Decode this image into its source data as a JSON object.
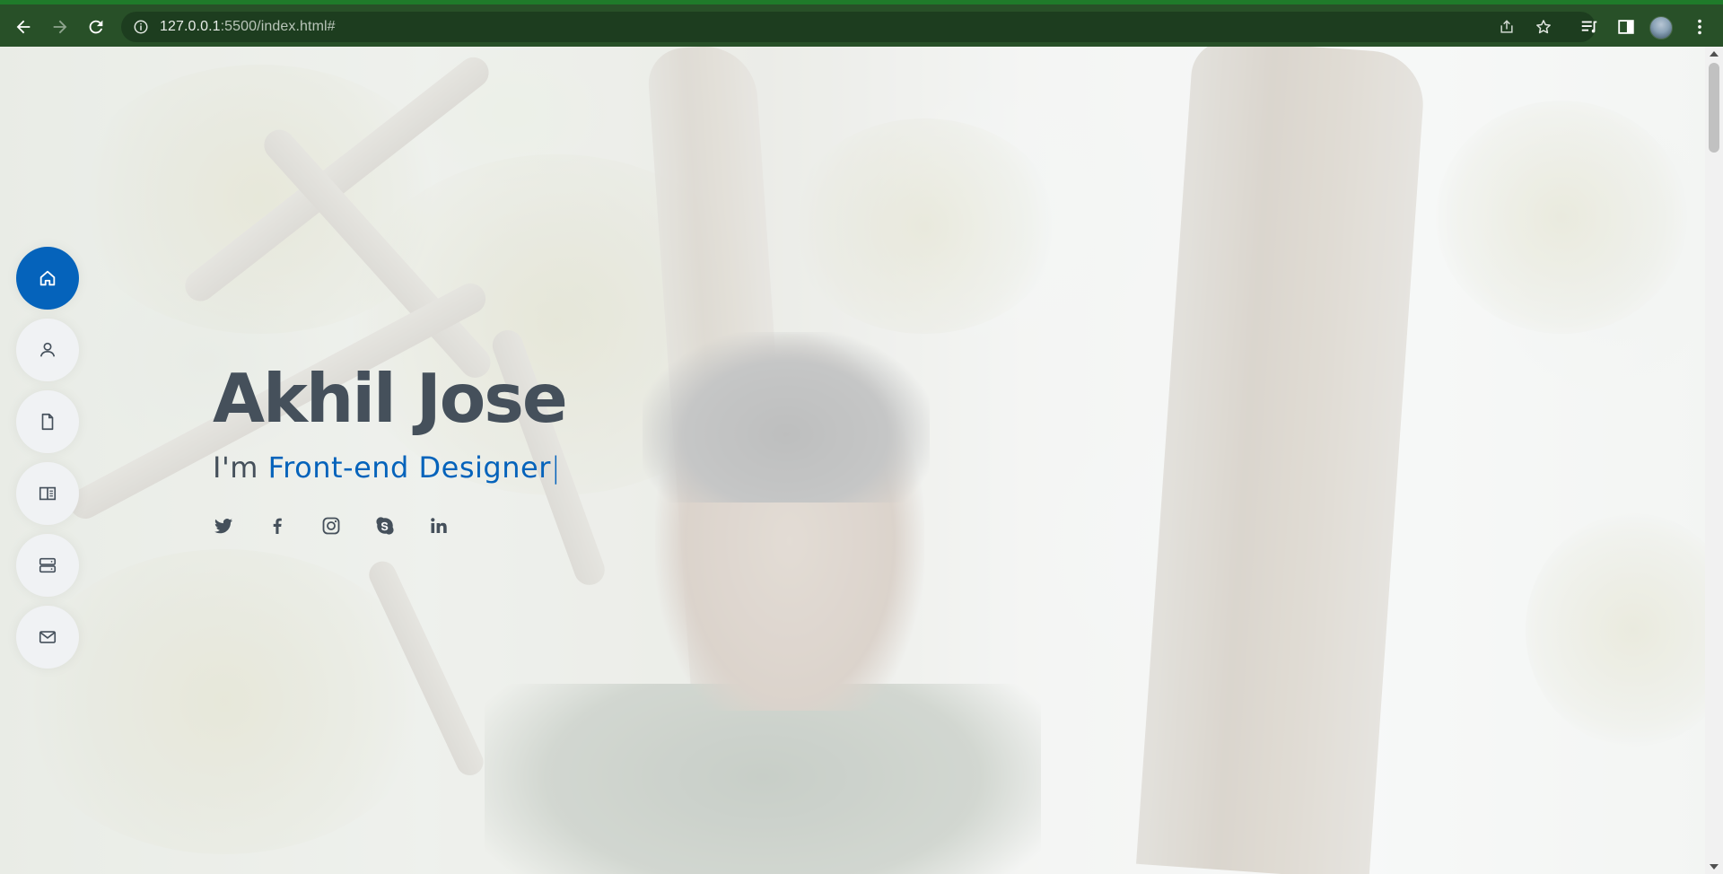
{
  "browser": {
    "url_host": "127.0.0.1",
    "url_rest": ":5500/index.html#",
    "icons": [
      "back-icon",
      "forward-icon",
      "reload-icon",
      "info-icon",
      "share-icon",
      "star-icon",
      "reading-list-icon",
      "side-panel-icon",
      "profile-avatar",
      "menu-icon"
    ]
  },
  "sidenav": {
    "items": [
      {
        "name": "home",
        "icon": "home-icon",
        "active": true
      },
      {
        "name": "about",
        "icon": "person-icon",
        "active": false
      },
      {
        "name": "resume",
        "icon": "file-icon",
        "active": false
      },
      {
        "name": "portfolio",
        "icon": "book-half-icon",
        "active": false
      },
      {
        "name": "services",
        "icon": "server-icon",
        "active": false
      },
      {
        "name": "contact",
        "icon": "envelope-icon",
        "active": false
      }
    ]
  },
  "hero": {
    "name": "Akhil Jose",
    "intro": "I'm ",
    "typed": "Front-end Designer",
    "cursor": "|"
  },
  "socials": [
    "twitter-icon",
    "facebook-icon",
    "instagram-icon",
    "skype-icon",
    "linkedin-icon"
  ],
  "colors": {
    "accent": "#0563bb",
    "heading": "#45505b",
    "chrome": "#285028"
  }
}
